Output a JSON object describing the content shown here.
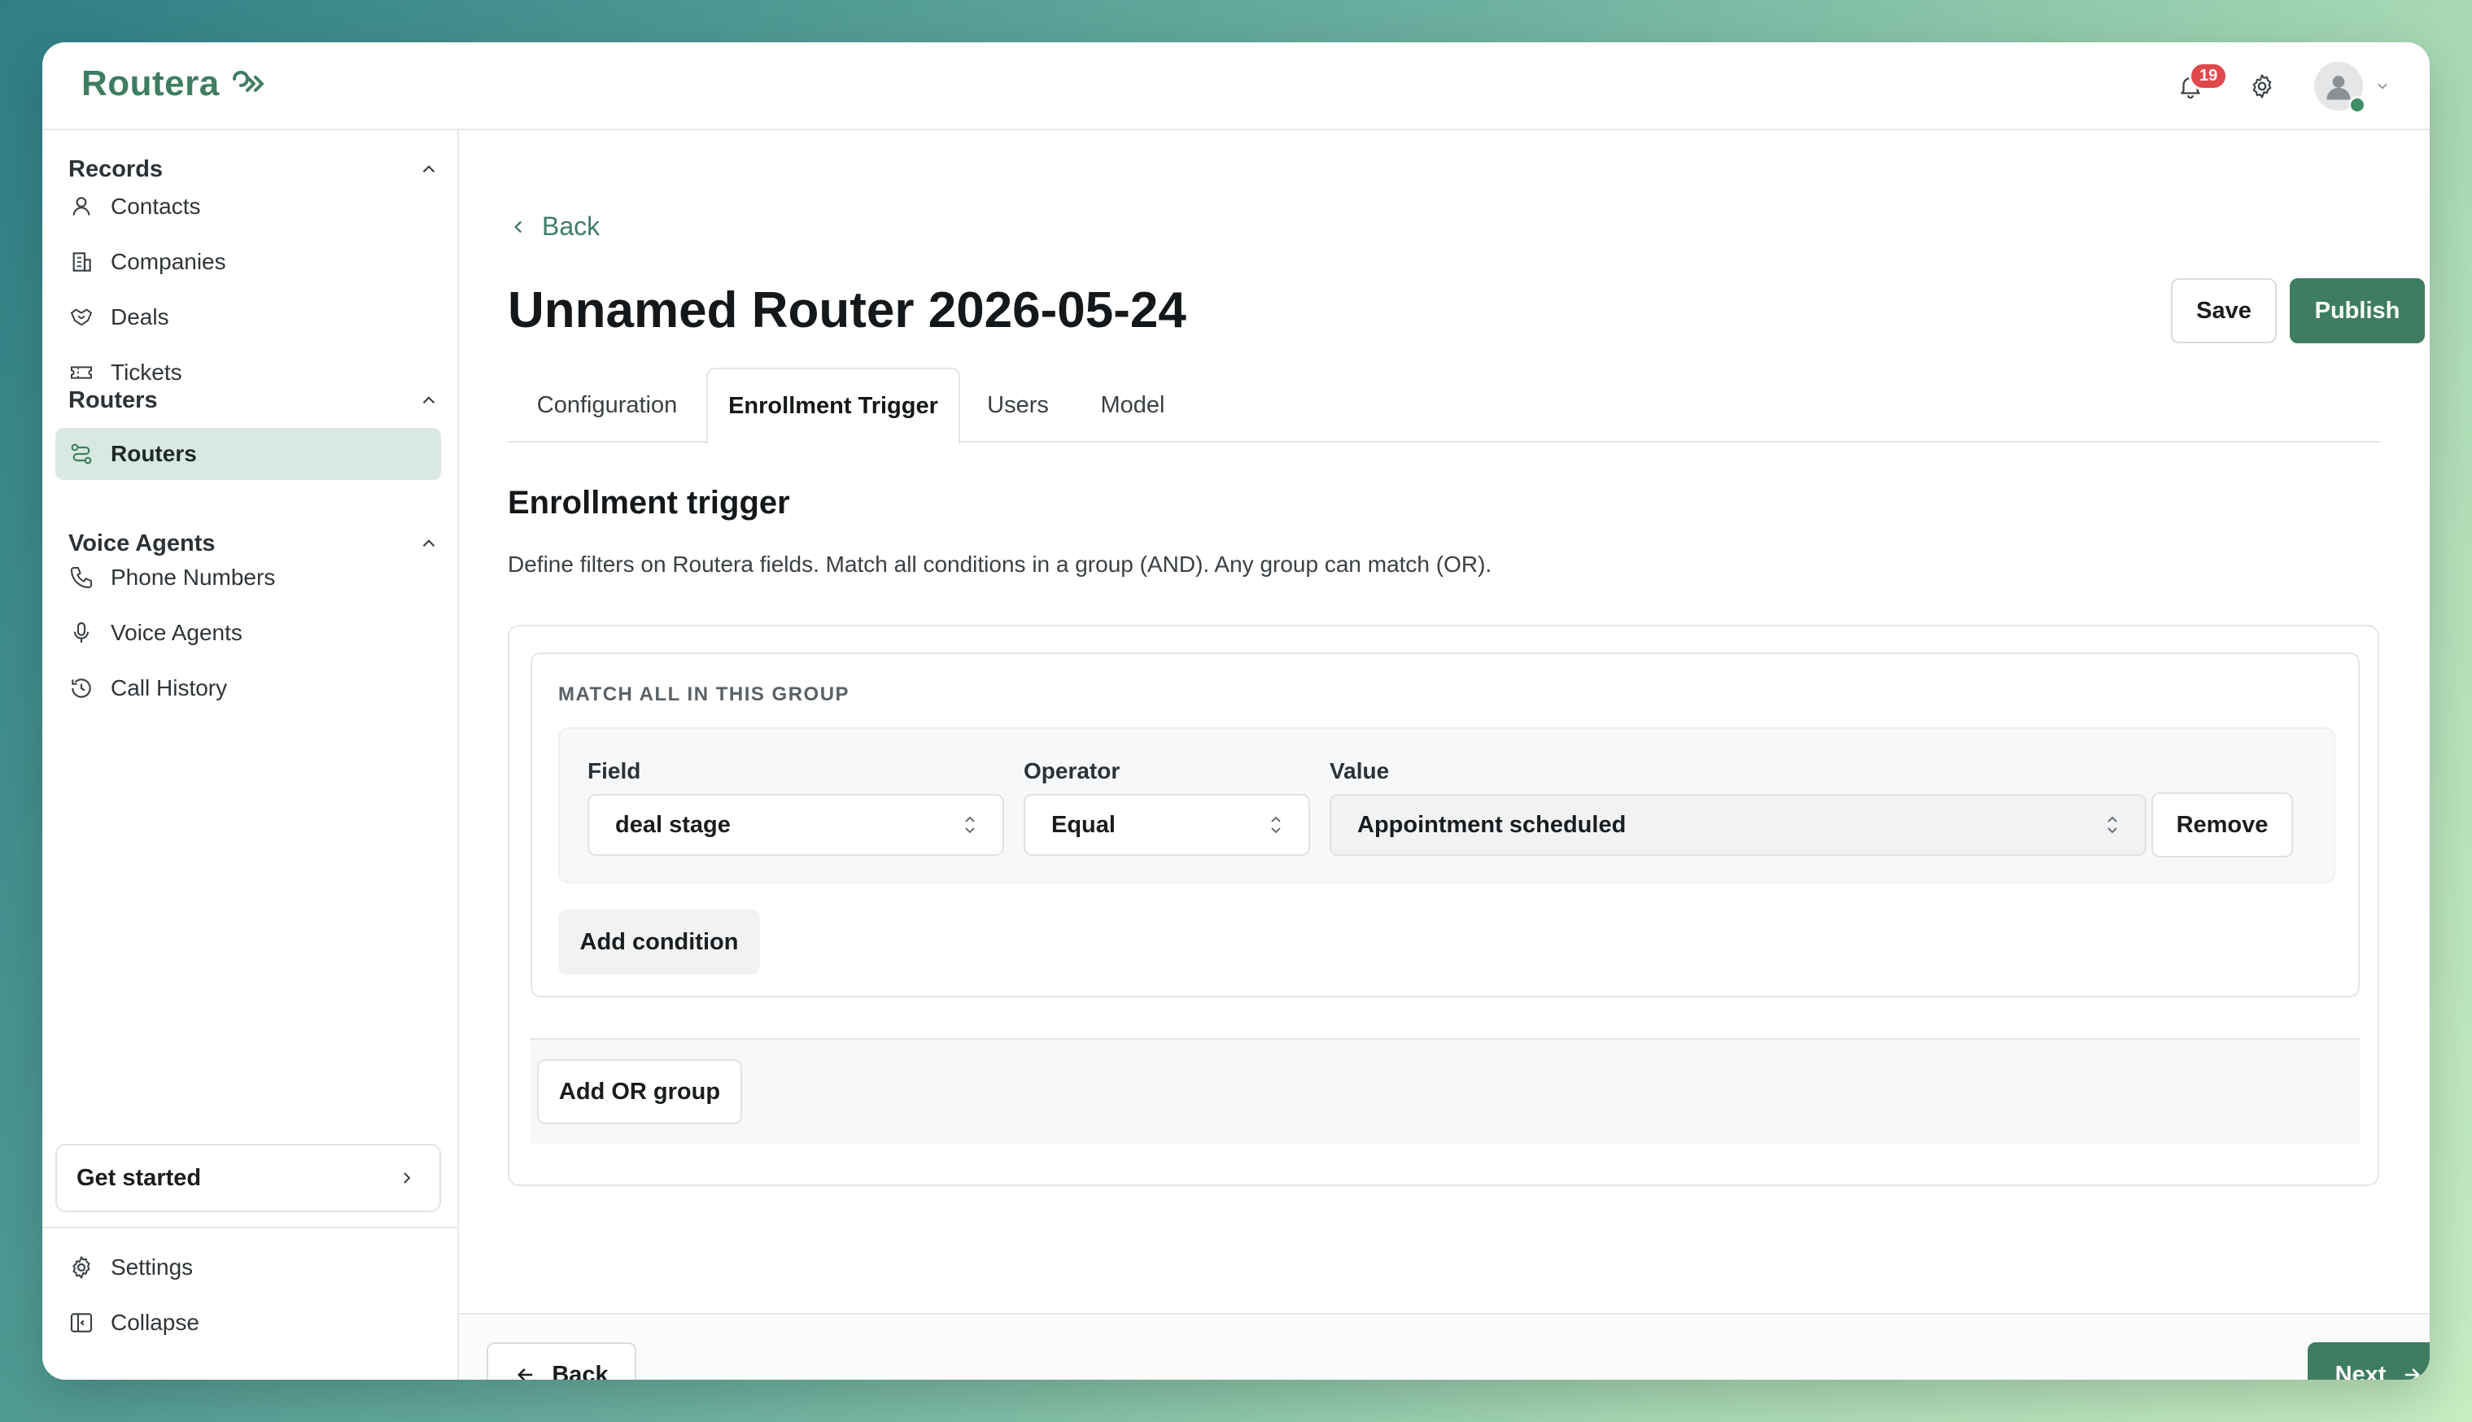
{
  "app": {
    "name": "Routera"
  },
  "header": {
    "notification_count": "19"
  },
  "sidebar": {
    "sections": [
      {
        "title": "Records",
        "items": [
          {
            "label": "Contacts",
            "icon": "person-icon"
          },
          {
            "label": "Companies",
            "icon": "building-icon"
          },
          {
            "label": "Deals",
            "icon": "handshake-icon"
          },
          {
            "label": "Tickets",
            "icon": "ticket-icon"
          }
        ]
      },
      {
        "title": "Routers",
        "items": [
          {
            "label": "Routers",
            "icon": "route-icon",
            "active": true
          }
        ]
      },
      {
        "title": "Voice Agents",
        "items": [
          {
            "label": "Phone Numbers",
            "icon": "phone-icon"
          },
          {
            "label": "Voice Agents",
            "icon": "microphone-icon"
          },
          {
            "label": "Call History",
            "icon": "history-icon"
          }
        ]
      }
    ],
    "get_started": "Get started",
    "settings": "Settings",
    "collapse": "Collapse"
  },
  "main": {
    "back": "Back",
    "title": "Unnamed Router 2026-05-24",
    "save": "Save",
    "publish": "Publish",
    "tabs": [
      {
        "label": "Configuration"
      },
      {
        "label": "Enrollment Trigger",
        "active": true
      },
      {
        "label": "Users"
      },
      {
        "label": "Model"
      }
    ],
    "section_title": "Enrollment trigger",
    "section_desc": "Define filters on Routera fields. Match all conditions in a group (AND). Any group can match (OR).",
    "group": {
      "label": "MATCH ALL IN THIS GROUP",
      "field_label": "Field",
      "operator_label": "Operator",
      "value_label": "Value",
      "field_value": "deal stage",
      "operator_value": "Equal",
      "value_value": "Appointment scheduled",
      "remove": "Remove",
      "add_condition": "Add condition"
    },
    "add_or_group": "Add OR group"
  },
  "footer": {
    "back": "Back",
    "next": "Next"
  },
  "colors": {
    "brand": "#3f7d63",
    "active_nav_bg": "#d9e9e1",
    "badge": "#e0484b"
  }
}
